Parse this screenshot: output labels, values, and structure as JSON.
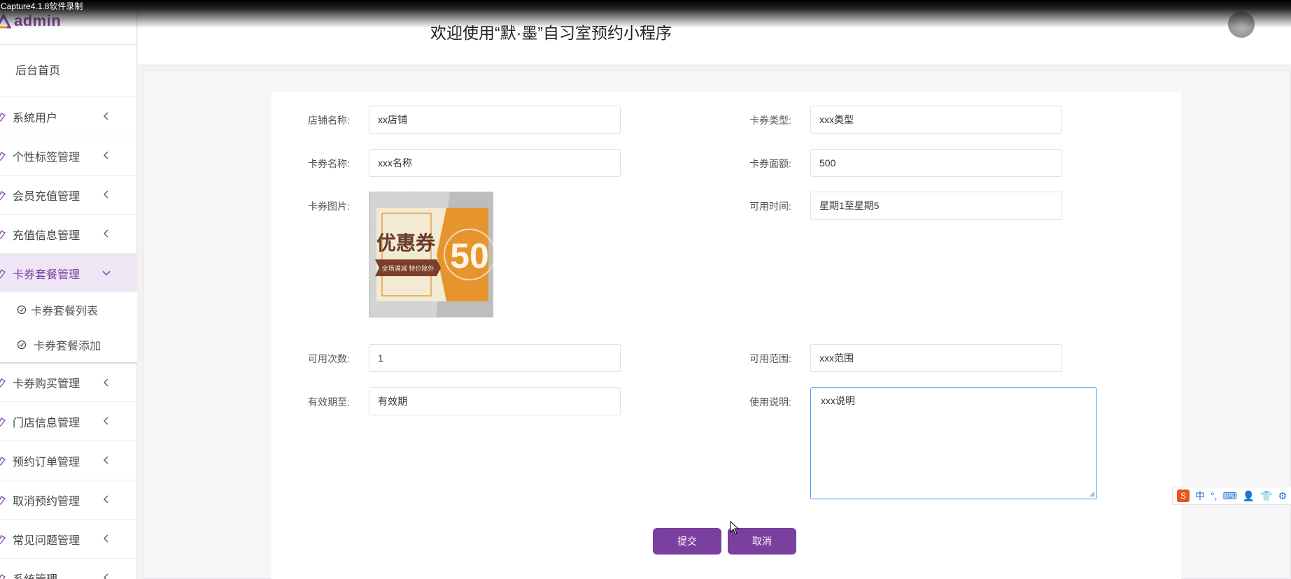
{
  "capture_banner": "Capture4.1.8软件录制",
  "app": {
    "logo_text": "admin",
    "header_title": "欢迎使用“默·墨”自习室预约小程序"
  },
  "sidebar": {
    "home": "后台首页",
    "items": [
      {
        "label": "系统用户"
      },
      {
        "label": "个性标签管理"
      },
      {
        "label": "会员充值管理"
      },
      {
        "label": "充值信息管理"
      },
      {
        "label": "卡券套餐管理",
        "expanded": true
      },
      {
        "label": "卡券购买管理"
      },
      {
        "label": "门店信息管理"
      },
      {
        "label": "预约订单管理"
      },
      {
        "label": "取消预约管理"
      },
      {
        "label": "常见问题管理"
      },
      {
        "label": "系统管理"
      }
    ],
    "sub_items": [
      {
        "label": "卡券套餐列表"
      },
      {
        "label": "卡券套餐添加"
      }
    ]
  },
  "form": {
    "shop_name_label": "店铺名称:",
    "shop_name_value": "xx店铺",
    "card_type_label": "卡券类型:",
    "card_type_value": "xxx类型",
    "card_name_label": "卡券名称:",
    "card_name_value": "xxx名称",
    "card_face_label": "卡券面额:",
    "card_face_value": "500",
    "card_image_label": "卡券图片:",
    "avail_time_label": "可用时间:",
    "avail_time_value": "星期1至星期5",
    "avail_count_label": "可用次数:",
    "avail_count_value": "1",
    "avail_scope_label": "可用范围:",
    "avail_scope_value": "xxx范围",
    "valid_until_label": "有效期至:",
    "valid_until_value": "有效期",
    "usage_label": "使用说明:",
    "usage_value": "xxx说明",
    "submit_label": "提交",
    "cancel_label": "取消"
  },
  "coupon_image": {
    "title_text": "优惠券",
    "amount": "50",
    "banner_text": "全场满减 特价除外"
  },
  "ime": {
    "lang": "中"
  },
  "colors": {
    "accent": "#7b3fa0",
    "focus_border": "#409eff",
    "coupon_orange": "#e6952e"
  }
}
